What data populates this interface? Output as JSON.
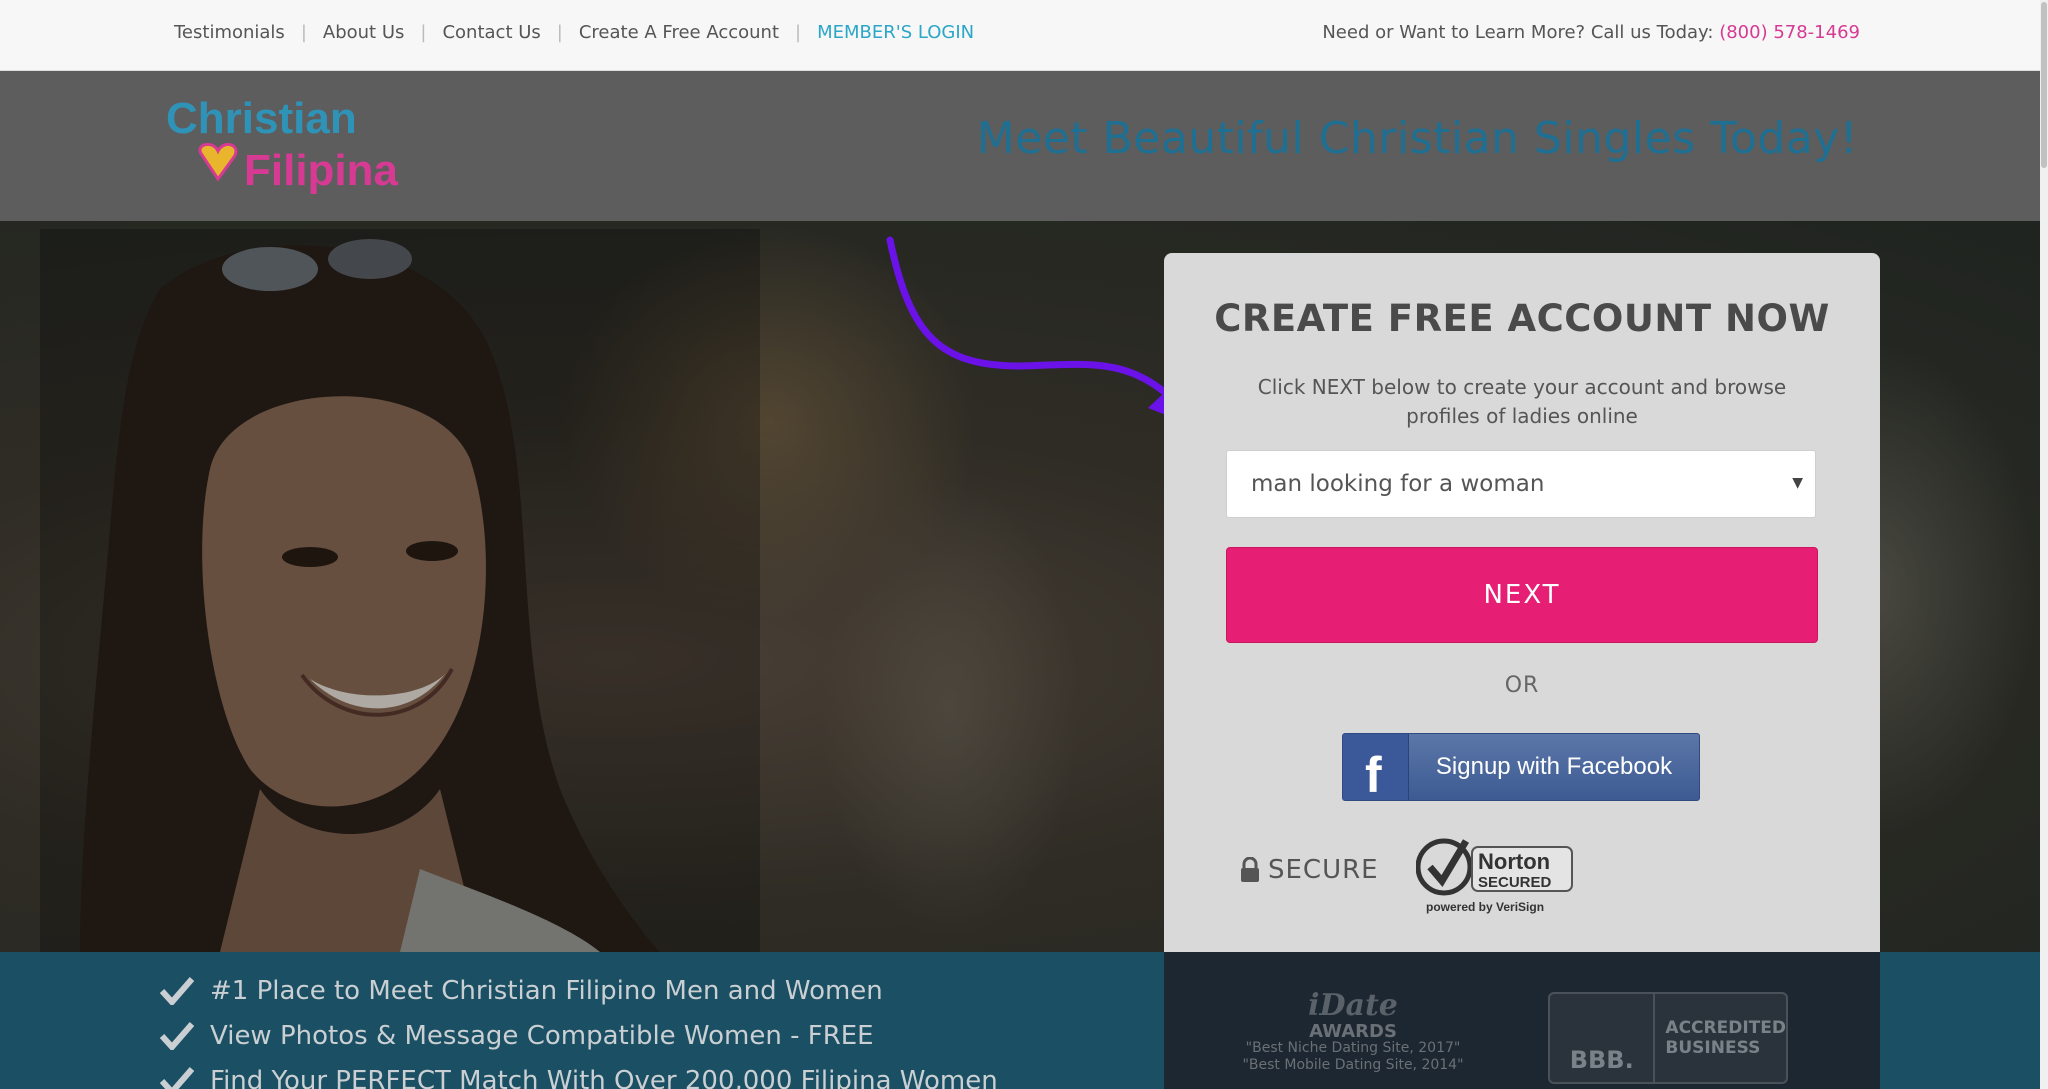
{
  "topbar": {
    "nav": [
      "Testimonials",
      "About Us",
      "Contact Us",
      "Create A Free Account",
      "MEMBER'S LOGIN"
    ],
    "separator": "|",
    "callus_prefix": "Need or Want to Learn More? Call us Today:",
    "phone": "(800) 578-1469"
  },
  "header": {
    "logo_line1": "Christian",
    "logo_line2": "Filipina",
    "tagline": "Meet Beautiful Christian Singles Today!"
  },
  "signup": {
    "title": "CREATE FREE ACCOUNT NOW",
    "subtitle": "Click NEXT below to create your account and browse profiles of ladies online",
    "select_value": "man looking for a woman",
    "next_label": "NEXT",
    "or_label": "OR",
    "facebook_label": "Signup with Facebook",
    "secure_label": "SECURE",
    "norton_line1": "Norton",
    "norton_line2": "SECURED",
    "norton_line3": "powered by VeriSign"
  },
  "benefits": [
    "#1 Place to Meet Christian Filipino Men and Women",
    "View Photos & Message Compatible Women - FREE",
    "Find Your PERFECT Match With Over 200,000 Filipina Women"
  ],
  "awards": {
    "title_line1": "iDate",
    "title_line2": "AWARDS",
    "line1": "\"Best Niche Dating Site, 2017\"",
    "line2": "\"Best Mobile Dating Site, 2014\""
  },
  "bbb": {
    "logo": "BBB.",
    "text_line1": "ACCREDITED",
    "text_line2": "BUSINESS"
  },
  "colors": {
    "accent_pink": "#e61f74",
    "link_blue": "#2aa6c8",
    "phone_pink": "#d63a93",
    "tagline_blue": "#1f6f93",
    "arrow_purple": "#6a12e8"
  }
}
